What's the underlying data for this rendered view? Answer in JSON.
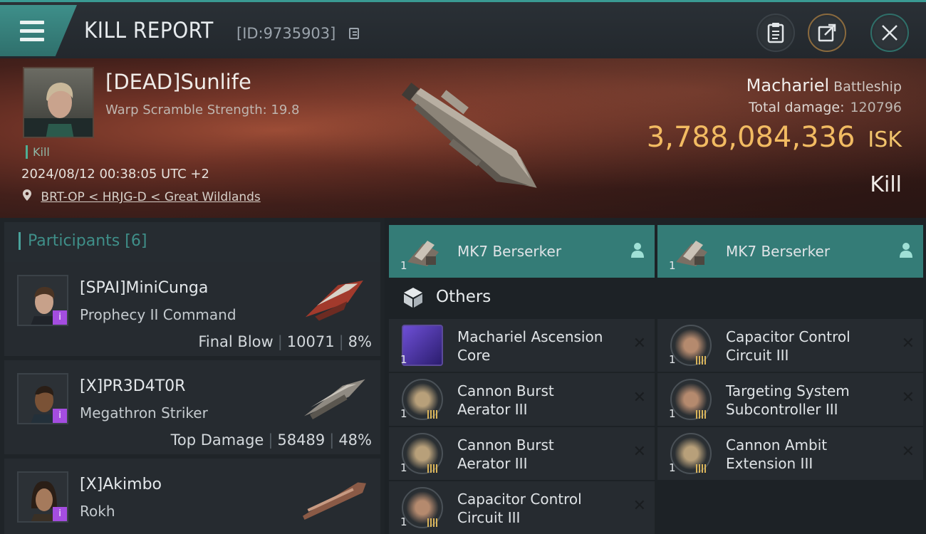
{
  "header": {
    "title": "KILL REPORT",
    "report_id": "[ID:9735903]"
  },
  "victim": {
    "name": "[DEAD]Sunlife",
    "scramble": "Warp Scramble Strength: 19.8",
    "tag": "Kill",
    "datetime": "2024/08/12 00:38:05 UTC +2",
    "location": "BRT-OP < HRJG-D < Great Wildlands",
    "ship": "Machariel",
    "ship_class": "Battleship",
    "damage_label": "Total damage:",
    "damage_value": "120796",
    "isk_value": "3,788,084,336",
    "isk_unit": "ISK",
    "result": "Kill"
  },
  "participants": {
    "label": "Participants",
    "count": "[6]",
    "rows": [
      {
        "name": "[SPAI]MiniCunga",
        "ship": "Prophecy II Command",
        "role": "Final Blow",
        "damage": "10071",
        "percent": "8%"
      },
      {
        "name": "[X]PR3D4T0R",
        "ship": "Megathron Striker",
        "role": "Top Damage",
        "damage": "58489",
        "percent": "48%"
      },
      {
        "name": "[X]Akimbo",
        "ship": "Rokh"
      }
    ]
  },
  "items": {
    "drones": [
      {
        "name": "MK7  Berserker",
        "qty": "1"
      },
      {
        "name": "MK7  Berserker",
        "qty": "1"
      }
    ],
    "others_label": "Others",
    "modules": [
      {
        "line1": "Machariel Ascension",
        "line2": "Core",
        "qty": "1"
      },
      {
        "line1": "Capacitor Control",
        "line2": "Circuit III",
        "qty": "1"
      },
      {
        "line1": "Cannon Burst",
        "line2": "Aerator III",
        "qty": "1"
      },
      {
        "line1": "Targeting System",
        "line2": "Subcontroller III",
        "qty": "1"
      },
      {
        "line1": "Cannon Burst",
        "line2": "Aerator III",
        "qty": "1"
      },
      {
        "line1": "Cannon Ambit",
        "line2": "Extension III",
        "qty": "1"
      },
      {
        "line1": "Capacitor Control",
        "line2": "Circuit III",
        "qty": "1"
      }
    ],
    "destroyed_mark": "✕"
  },
  "colors": {
    "accent": "#3e8f8a",
    "isk": "#f2bb62",
    "badge": "#a44de0"
  }
}
